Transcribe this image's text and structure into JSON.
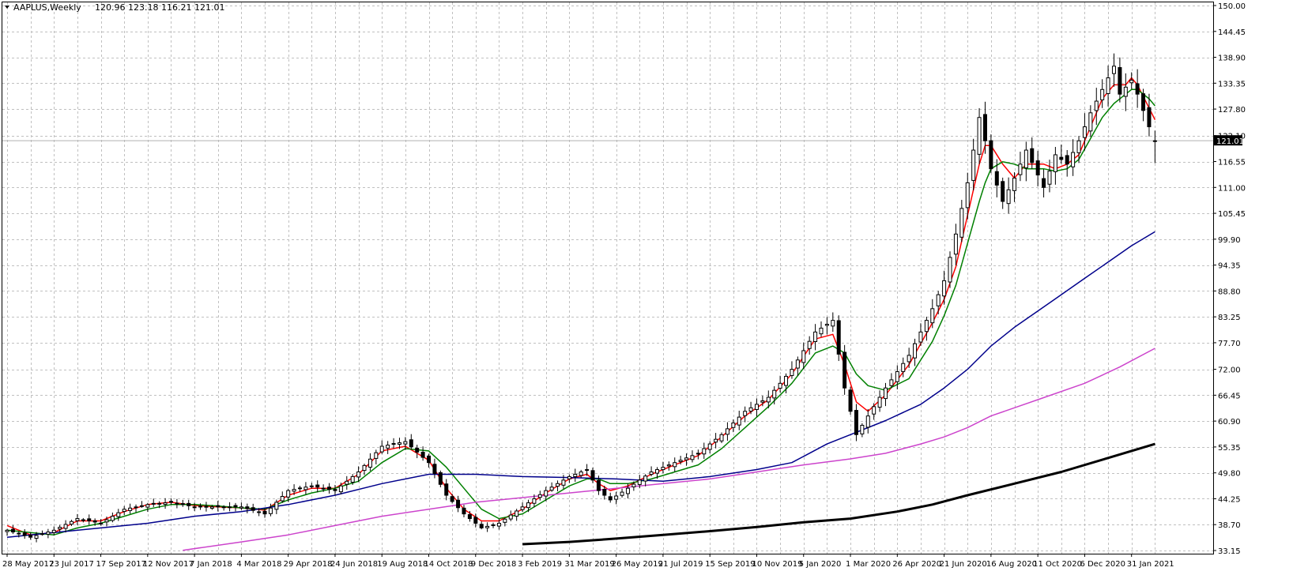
{
  "header": {
    "symbol": "AAPLUS,Weekly",
    "ohlc": "120.96 123.18 116.21 121.01"
  },
  "colors": {
    "background": "#ffffff",
    "grid": "#c0c0c0",
    "candle_bull_body": "#ffffff",
    "candle_bear_body": "#000000",
    "candle_outline": "#000000",
    "ma_fast": "#ff0000",
    "ma_slow": "#008000",
    "ma_100": "#00008b",
    "ma_150": "#cc44cc",
    "ma_200": "#000000",
    "last_price_box": "#000000",
    "last_price_text": "#ffffff"
  },
  "chart_data": {
    "type": "candlestick",
    "symbol": "AAPLUS",
    "timeframe": "Weekly",
    "last_price": "121.01",
    "y_ticks": [
      "150.00",
      "144.45",
      "138.90",
      "133.35",
      "127.80",
      "122.10",
      "116.55",
      "111.00",
      "105.45",
      "99.90",
      "94.35",
      "88.80",
      "83.25",
      "77.70",
      "72.00",
      "66.45",
      "60.90",
      "55.35",
      "49.80",
      "44.25",
      "38.70",
      "33.15"
    ],
    "ylim": [
      33.15,
      150.0
    ],
    "x_ticks": [
      "28 May 2017",
      "23 Jul 2017",
      "17 Sep 2017",
      "12 Nov 2017",
      "7 Jan 2018",
      "4 Mar 2018",
      "29 Apr 2018",
      "24 Jun 2018",
      "19 Aug 2018",
      "14 Oct 2018",
      "9 Dec 2018",
      "3 Feb 2019",
      "31 Mar 2019",
      "26 May 2019",
      "21 Jul 2019",
      "15 Sep 2019",
      "10 Nov 2019",
      "5 Jan 2020",
      "1 Mar 2020",
      "26 Apr 2020",
      "21 Jun 2020",
      "16 Aug 2020",
      "11 Oct 2020",
      "6 Dec 2020",
      "31 Jan 2021"
    ],
    "x_tick_week_index": [
      0,
      8,
      16,
      24,
      32,
      40,
      48,
      56,
      64,
      72,
      80,
      88,
      96,
      104,
      112,
      120,
      128,
      136,
      144,
      152,
      160,
      168,
      176,
      184,
      192
    ],
    "close_anchors": [
      [
        0,
        37.5
      ],
      [
        4,
        36.0
      ],
      [
        8,
        37.5
      ],
      [
        12,
        40.0
      ],
      [
        16,
        39.0
      ],
      [
        20,
        42.0
      ],
      [
        24,
        43.0
      ],
      [
        28,
        43.5
      ],
      [
        32,
        42.5
      ],
      [
        36,
        42.5
      ],
      [
        40,
        42.5
      ],
      [
        44,
        41.0
      ],
      [
        48,
        46.0
      ],
      [
        52,
        47.0
      ],
      [
        56,
        46.0
      ],
      [
        60,
        50.0
      ],
      [
        64,
        55.5
      ],
      [
        68,
        56.5
      ],
      [
        72,
        52.0
      ],
      [
        75,
        45.0
      ],
      [
        78,
        41.0
      ],
      [
        81,
        38.0
      ],
      [
        84,
        39.0
      ],
      [
        88,
        42.5
      ],
      [
        92,
        46.0
      ],
      [
        96,
        49.0
      ],
      [
        99,
        50.5
      ],
      [
        101,
        46.0
      ],
      [
        103,
        44.0
      ],
      [
        106,
        46.5
      ],
      [
        110,
        50.0
      ],
      [
        114,
        52.0
      ],
      [
        118,
        54.0
      ],
      [
        122,
        58.0
      ],
      [
        126,
        63.0
      ],
      [
        130,
        66.0
      ],
      [
        134,
        72.0
      ],
      [
        138,
        80.0
      ],
      [
        141,
        82.5
      ],
      [
        143,
        68.0
      ],
      [
        145,
        58.0
      ],
      [
        147,
        62.0
      ],
      [
        150,
        68.0
      ],
      [
        154,
        75.0
      ],
      [
        158,
        85.0
      ],
      [
        160,
        91.0
      ],
      [
        162,
        101.0
      ],
      [
        164,
        112.0
      ],
      [
        166,
        126.0
      ],
      [
        167,
        121.0
      ],
      [
        168,
        115.0
      ],
      [
        170,
        108.0
      ],
      [
        172,
        113.0
      ],
      [
        174,
        119.0
      ],
      [
        177,
        111.0
      ],
      [
        179,
        118.0
      ],
      [
        181,
        116.0
      ],
      [
        183,
        121.0
      ],
      [
        185,
        127.0
      ],
      [
        187,
        132.0
      ],
      [
        189,
        137.0
      ],
      [
        190,
        131.0
      ],
      [
        192,
        134.0
      ],
      [
        193,
        131.0
      ],
      [
        195,
        124.0
      ],
      [
        196,
        121.01
      ]
    ],
    "indicators": [
      {
        "name": "ma_fast",
        "color": "#ff0000",
        "points": [
          [
            0,
            38.5
          ],
          [
            4,
            36.5
          ],
          [
            8,
            37.0
          ],
          [
            12,
            39.5
          ],
          [
            16,
            39.5
          ],
          [
            20,
            41.5
          ],
          [
            24,
            43.0
          ],
          [
            28,
            43.5
          ],
          [
            32,
            42.8
          ],
          [
            36,
            42.5
          ],
          [
            40,
            42.3
          ],
          [
            44,
            41.8
          ],
          [
            48,
            45.0
          ],
          [
            52,
            46.5
          ],
          [
            56,
            46.5
          ],
          [
            60,
            49.5
          ],
          [
            64,
            54.5
          ],
          [
            68,
            55.5
          ],
          [
            72,
            52.5
          ],
          [
            75,
            46.5
          ],
          [
            78,
            42.0
          ],
          [
            81,
            39.5
          ],
          [
            84,
            39.5
          ],
          [
            88,
            42.0
          ],
          [
            92,
            45.5
          ],
          [
            96,
            48.5
          ],
          [
            99,
            49.5
          ],
          [
            101,
            47.5
          ],
          [
            103,
            46.0
          ],
          [
            106,
            47.0
          ],
          [
            110,
            49.5
          ],
          [
            114,
            51.5
          ],
          [
            118,
            53.5
          ],
          [
            122,
            57.5
          ],
          [
            126,
            62.0
          ],
          [
            130,
            65.5
          ],
          [
            134,
            71.0
          ],
          [
            138,
            78.5
          ],
          [
            141,
            79.5
          ],
          [
            143,
            73.0
          ],
          [
            145,
            65.0
          ],
          [
            147,
            63.0
          ],
          [
            150,
            66.5
          ],
          [
            154,
            73.0
          ],
          [
            158,
            82.0
          ],
          [
            160,
            87.0
          ],
          [
            162,
            94.0
          ],
          [
            164,
            105.0
          ],
          [
            166,
            116.0
          ],
          [
            167,
            120.0
          ],
          [
            168,
            120.0
          ],
          [
            170,
            116.0
          ],
          [
            172,
            113.0
          ],
          [
            174,
            116.0
          ],
          [
            177,
            116.0
          ],
          [
            179,
            115.0
          ],
          [
            181,
            116.0
          ],
          [
            183,
            118.0
          ],
          [
            185,
            124.0
          ],
          [
            187,
            130.0
          ],
          [
            189,
            133.0
          ],
          [
            191,
            133.0
          ],
          [
            192,
            134.5
          ],
          [
            193,
            133.0
          ],
          [
            195,
            128.0
          ],
          [
            196,
            125.5
          ]
        ]
      },
      {
        "name": "ma_slow",
        "color": "#008000",
        "points": [
          [
            0,
            37.5
          ],
          [
            4,
            37.0
          ],
          [
            8,
            36.5
          ],
          [
            12,
            38.0
          ],
          [
            16,
            39.0
          ],
          [
            20,
            40.5
          ],
          [
            24,
            42.0
          ],
          [
            28,
            43.0
          ],
          [
            32,
            43.0
          ],
          [
            36,
            42.7
          ],
          [
            40,
            42.3
          ],
          [
            44,
            42.0
          ],
          [
            48,
            44.0
          ],
          [
            52,
            45.5
          ],
          [
            56,
            46.5
          ],
          [
            60,
            48.0
          ],
          [
            64,
            52.0
          ],
          [
            68,
            55.0
          ],
          [
            72,
            54.5
          ],
          [
            75,
            51.0
          ],
          [
            78,
            46.5
          ],
          [
            81,
            42.0
          ],
          [
            84,
            40.0
          ],
          [
            88,
            41.0
          ],
          [
            92,
            44.0
          ],
          [
            96,
            47.0
          ],
          [
            99,
            48.5
          ],
          [
            101,
            48.5
          ],
          [
            103,
            47.5
          ],
          [
            106,
            47.5
          ],
          [
            110,
            48.5
          ],
          [
            114,
            50.0
          ],
          [
            118,
            51.5
          ],
          [
            122,
            55.0
          ],
          [
            126,
            59.5
          ],
          [
            130,
            64.0
          ],
          [
            134,
            69.0
          ],
          [
            138,
            75.5
          ],
          [
            141,
            77.0
          ],
          [
            143,
            75.5
          ],
          [
            145,
            71.0
          ],
          [
            147,
            68.5
          ],
          [
            150,
            67.5
          ],
          [
            154,
            70.0
          ],
          [
            158,
            78.0
          ],
          [
            160,
            83.5
          ],
          [
            162,
            90.0
          ],
          [
            164,
            99.0
          ],
          [
            166,
            108.0
          ],
          [
            167,
            112.0
          ],
          [
            168,
            115.0
          ],
          [
            170,
            116.5
          ],
          [
            172,
            116.0
          ],
          [
            174,
            115.0
          ],
          [
            177,
            115.0
          ],
          [
            179,
            114.5
          ],
          [
            181,
            115.0
          ],
          [
            183,
            117.0
          ],
          [
            185,
            121.5
          ],
          [
            187,
            126.0
          ],
          [
            189,
            129.0
          ],
          [
            191,
            131.0
          ],
          [
            192,
            132.0
          ],
          [
            193,
            132.0
          ],
          [
            195,
            130.0
          ],
          [
            196,
            128.5
          ]
        ]
      },
      {
        "name": "ma_100",
        "color": "#00008b",
        "points": [
          [
            0,
            36.0
          ],
          [
            8,
            37.0
          ],
          [
            16,
            38.0
          ],
          [
            24,
            39.0
          ],
          [
            32,
            40.5
          ],
          [
            40,
            41.5
          ],
          [
            48,
            43.0
          ],
          [
            56,
            45.0
          ],
          [
            64,
            47.5
          ],
          [
            72,
            49.5
          ],
          [
            80,
            49.5
          ],
          [
            88,
            49.0
          ],
          [
            96,
            48.8
          ],
          [
            104,
            48.5
          ],
          [
            112,
            48.0
          ],
          [
            120,
            49.0
          ],
          [
            128,
            50.5
          ],
          [
            134,
            52.0
          ],
          [
            140,
            56.0
          ],
          [
            144,
            58.0
          ],
          [
            150,
            61.0
          ],
          [
            156,
            64.5
          ],
          [
            160,
            68.0
          ],
          [
            164,
            72.0
          ],
          [
            168,
            77.0
          ],
          [
            172,
            81.0
          ],
          [
            176,
            84.5
          ],
          [
            180,
            88.0
          ],
          [
            184,
            91.5
          ],
          [
            188,
            95.0
          ],
          [
            192,
            98.5
          ],
          [
            196,
            101.5
          ]
        ]
      },
      {
        "name": "ma_150",
        "color": "#cc44cc",
        "points": [
          [
            30,
            33.2
          ],
          [
            40,
            35.0
          ],
          [
            48,
            36.5
          ],
          [
            56,
            38.5
          ],
          [
            64,
            40.5
          ],
          [
            72,
            42.0
          ],
          [
            80,
            43.5
          ],
          [
            88,
            44.5
          ],
          [
            96,
            45.5
          ],
          [
            104,
            46.5
          ],
          [
            112,
            47.5
          ],
          [
            120,
            48.5
          ],
          [
            128,
            50.0
          ],
          [
            136,
            51.5
          ],
          [
            144,
            52.8
          ],
          [
            150,
            54.0
          ],
          [
            156,
            56.0
          ],
          [
            160,
            57.5
          ],
          [
            164,
            59.5
          ],
          [
            168,
            62.0
          ],
          [
            176,
            65.5
          ],
          [
            184,
            69.0
          ],
          [
            190,
            72.5
          ],
          [
            196,
            76.5
          ]
        ]
      },
      {
        "name": "ma_200",
        "color": "#000000",
        "points": [
          [
            88,
            34.5
          ],
          [
            96,
            35.0
          ],
          [
            104,
            35.7
          ],
          [
            112,
            36.5
          ],
          [
            120,
            37.3
          ],
          [
            128,
            38.2
          ],
          [
            136,
            39.2
          ],
          [
            144,
            40.0
          ],
          [
            152,
            41.5
          ],
          [
            158,
            43.0
          ],
          [
            164,
            45.0
          ],
          [
            172,
            47.5
          ],
          [
            180,
            50.0
          ],
          [
            188,
            53.0
          ],
          [
            196,
            56.0
          ]
        ]
      }
    ]
  }
}
